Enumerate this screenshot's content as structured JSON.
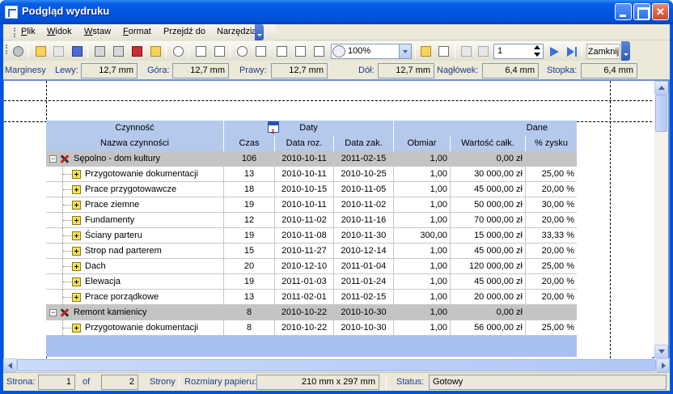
{
  "window": {
    "title": "Podgląd wydruku"
  },
  "menu": {
    "items": [
      "Plik",
      "Widok",
      "Wstaw",
      "Format",
      "Przejdź do",
      "Narzędzia"
    ]
  },
  "toolbar": {
    "zoom": "100%",
    "page": "1",
    "close_label": "Zamknij",
    "icons": [
      "gear-icon",
      "open-icon",
      "open-disabled-icon",
      "save-icon",
      "print-icon",
      "print-setup-icon",
      "pdf-export-icon",
      "edit-icon",
      "find-icon",
      "page-setup-icon",
      "header-icon",
      "footer-icon",
      "zoom-icon",
      "fit-width-icon",
      "one-page-icon",
      "two-pages-icon",
      "multi-page-icon",
      "color-icon",
      "watermark-icon",
      "first-page-icon",
      "prev-page-icon",
      "next-page-icon",
      "last-page-icon"
    ]
  },
  "margins": {
    "label": "Marginesy",
    "left_label": "Lewy:",
    "left": "12,7 mm",
    "top_label": "Góra:",
    "top": "12,7 mm",
    "right_label": "Prawy:",
    "right": "12,7 mm",
    "bottom_label": "Dół:",
    "bottom": "12,7 mm",
    "header_label": "Nagłówek:",
    "header": "6,4 mm",
    "footer_label": "Stopka:",
    "footer": "6,4 mm"
  },
  "report": {
    "group_headers": {
      "activity": "Czynność",
      "dates": "Daty",
      "data": "Dane"
    },
    "columns": [
      "Nazwa czynności",
      "Czas",
      "Data roz.",
      "Data zak.",
      "Obmiar",
      "Wartość całk.",
      "% zysku"
    ],
    "rows": [
      {
        "level": 0,
        "name": "Sępolno - dom kultury",
        "czas": "106",
        "start": "2010-10-11",
        "end": "2011-02-15",
        "obmiar": "1,00",
        "wartosc": "0,00 zł",
        "zysk": ""
      },
      {
        "level": 1,
        "name": "Przygotowanie dokumentacji",
        "czas": "13",
        "start": "2010-10-11",
        "end": "2010-10-25",
        "obmiar": "1,00",
        "wartosc": "30 000,00 zł",
        "zysk": "25,00 %"
      },
      {
        "level": 1,
        "name": "Prace przygotowawcze",
        "czas": "18",
        "start": "2010-10-15",
        "end": "2010-11-05",
        "obmiar": "1,00",
        "wartosc": "45 000,00 zł",
        "zysk": "20,00 %"
      },
      {
        "level": 1,
        "name": "Prace ziemne",
        "czas": "19",
        "start": "2010-10-11",
        "end": "2010-11-02",
        "obmiar": "1,00",
        "wartosc": "50 000,00 zł",
        "zysk": "30,00 %"
      },
      {
        "level": 1,
        "name": "Fundamenty",
        "czas": "12",
        "start": "2010-11-02",
        "end": "2010-11-16",
        "obmiar": "1,00",
        "wartosc": "70 000,00 zł",
        "zysk": "20,00 %"
      },
      {
        "level": 1,
        "name": "Ściany parteru",
        "czas": "19",
        "start": "2010-11-08",
        "end": "2010-11-30",
        "obmiar": "300,00",
        "wartosc": "15 000,00 zł",
        "zysk": "33,33 %"
      },
      {
        "level": 1,
        "name": "Strop nad parterem",
        "czas": "15",
        "start": "2010-11-27",
        "end": "2010-12-14",
        "obmiar": "1,00",
        "wartosc": "45 000,00 zł",
        "zysk": "20,00 %"
      },
      {
        "level": 1,
        "name": "Dach",
        "czas": "20",
        "start": "2010-12-10",
        "end": "2011-01-04",
        "obmiar": "1,00",
        "wartosc": "120 000,00 zł",
        "zysk": "25,00 %"
      },
      {
        "level": 1,
        "name": "Elewacja",
        "czas": "19",
        "start": "2011-01-03",
        "end": "2011-01-24",
        "obmiar": "1,00",
        "wartosc": "45 000,00 zł",
        "zysk": "20,00 %"
      },
      {
        "level": 1,
        "name": "Prace porządkowe",
        "czas": "13",
        "start": "2011-02-01",
        "end": "2011-02-15",
        "obmiar": "1,00",
        "wartosc": "20 000,00 zł",
        "zysk": "20,00 %"
      },
      {
        "level": 0,
        "name": "Remont kamienicy",
        "czas": "8",
        "start": "2010-10-22",
        "end": "2010-10-30",
        "obmiar": "1,00",
        "wartosc": "0,00 zł",
        "zysk": ""
      },
      {
        "level": 1,
        "name": "Przygotowanie dokumentacji",
        "czas": "8",
        "start": "2010-10-22",
        "end": "2010-10-30",
        "obmiar": "1,00",
        "wartosc": "56 000,00 zł",
        "zysk": "25,00 %"
      }
    ]
  },
  "status": {
    "page_label": "Strona:",
    "page": "1",
    "of_label": "of",
    "pages": "2",
    "pages_label": "Strony",
    "paper_label": "Rozmiary papieru:",
    "paper": "210 mm x 297 mm",
    "status_label": "Status:",
    "status": "Gotowy"
  },
  "colors": {
    "titlebar": "#0054e3",
    "header": "#b5c9ec",
    "group_row": "#c4c4c4",
    "band": "#a8c0ef"
  }
}
